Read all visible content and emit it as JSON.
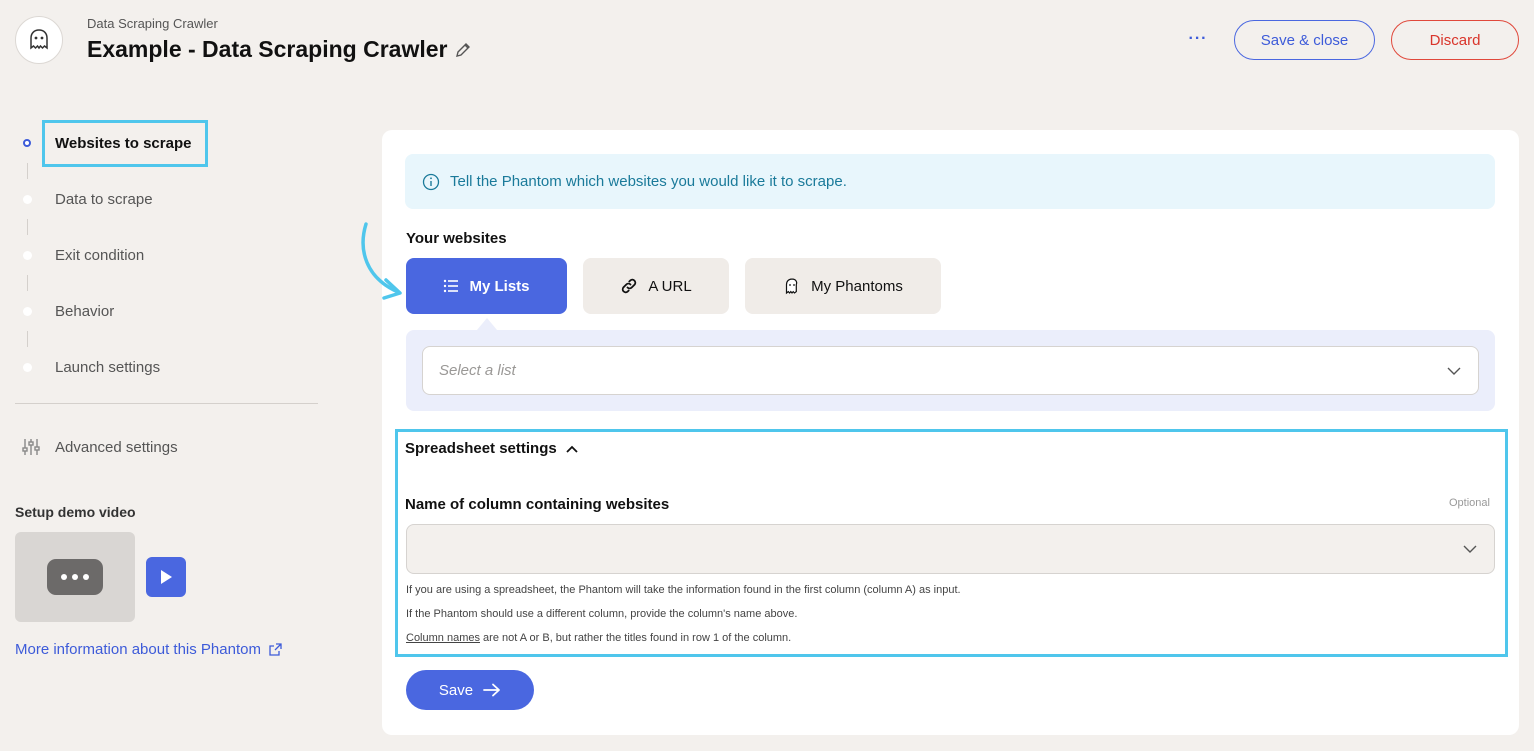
{
  "header": {
    "subtitle": "Data Scraping Crawler",
    "title": "Example - Data Scraping Crawler",
    "more_label": "···",
    "save_close_label": "Save & close",
    "discard_label": "Discard"
  },
  "sidebar": {
    "steps": [
      {
        "label": "Websites to scrape",
        "active": true
      },
      {
        "label": "Data to scrape",
        "active": false
      },
      {
        "label": "Exit condition",
        "active": false
      },
      {
        "label": "Behavior",
        "active": false
      },
      {
        "label": "Launch settings",
        "active": false
      }
    ],
    "advanced_label": "Advanced settings",
    "demo_title": "Setup demo video",
    "more_info_label": "More information about this Phantom"
  },
  "main": {
    "info_text": "Tell the Phantom which websites you would like it to scrape.",
    "your_websites_label": "Your websites",
    "tabs": [
      {
        "label": "My Lists",
        "icon": "list-icon",
        "active": true
      },
      {
        "label": "A URL",
        "icon": "link-icon",
        "active": false
      },
      {
        "label": "My Phantoms",
        "icon": "phantom-icon",
        "active": false
      }
    ],
    "select_list_placeholder": "Select a list",
    "spreadsheet": {
      "title": "Spreadsheet settings",
      "column_label": "Name of column containing websites",
      "optional_label": "Optional",
      "help_1": "If you are using a spreadsheet, the Phantom will take the information found in the first column (column A) as input.",
      "help_2": "If the Phantom should use a different column, provide the column's name above.",
      "help_3_link": "Column names",
      "help_3_rest": " are not A or B, but rather the titles found in row 1 of the column."
    },
    "save_label": "Save"
  },
  "colors": {
    "accent": "#4a67e0",
    "discard": "#e0483b",
    "highlight": "#4fc6ec",
    "background": "#f3f0ed"
  }
}
